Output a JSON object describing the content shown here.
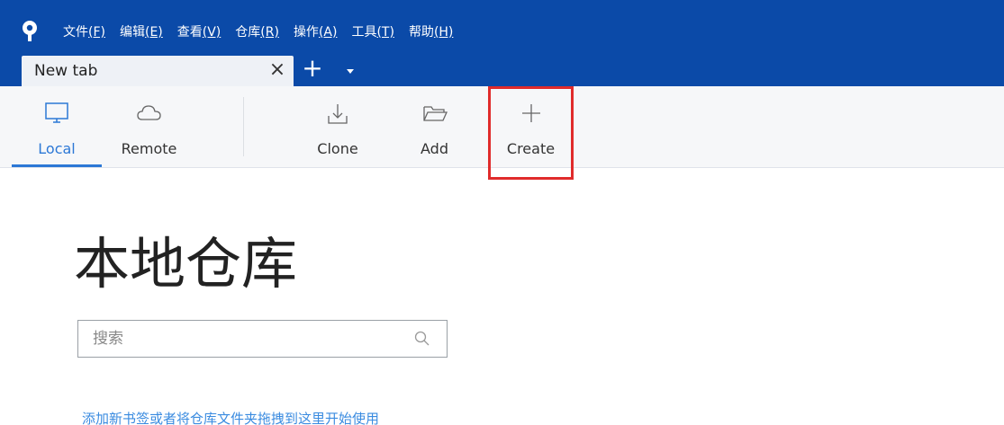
{
  "menu": [
    {
      "label": "文件",
      "accel": "(F)"
    },
    {
      "label": "编辑",
      "accel": "(E)"
    },
    {
      "label": "查看",
      "accel": "(V)"
    },
    {
      "label": "仓库",
      "accel": "(R)"
    },
    {
      "label": "操作",
      "accel": "(A)"
    },
    {
      "label": "工具",
      "accel": "(T)"
    },
    {
      "label": "帮助",
      "accel": "(H)"
    }
  ],
  "tab": {
    "title": "New tab",
    "close": "×",
    "add": "+"
  },
  "toolbar": {
    "local": "Local",
    "remote": "Remote",
    "clone": "Clone",
    "add": "Add",
    "create": "Create"
  },
  "main": {
    "title": "本地仓库",
    "search_placeholder": "搜索",
    "hint": "添加新书签或者将仓库文件夹拖拽到这里开始使用"
  },
  "colors": {
    "titlebar": "#0b4aa8",
    "accent": "#2c78d6",
    "highlight": "#e02b2b"
  }
}
